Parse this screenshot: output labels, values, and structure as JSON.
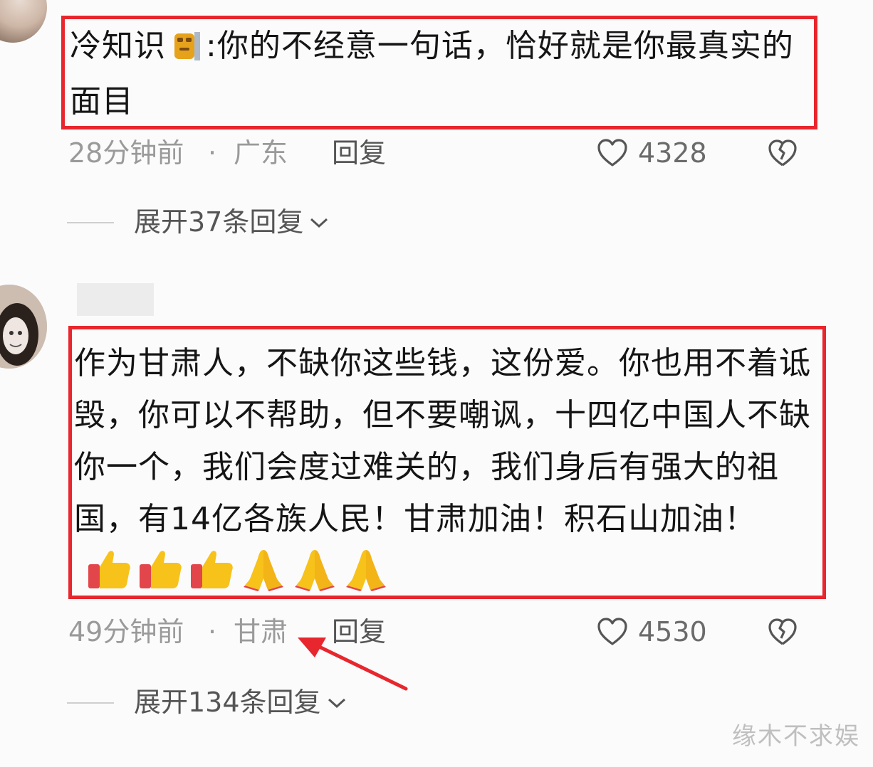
{
  "comments": [
    {
      "text_before_emoji": "冷知识",
      "emoji": "cat-face-emoji",
      "text_after_emoji": ":你的不经意一句话，恰好就是你最真实的面目",
      "time": "28分钟前",
      "separator": "·",
      "location": "广东",
      "reply_label": "回复",
      "like_count": "4328",
      "expand_label": "展开37条回复"
    },
    {
      "text": "作为甘肃人，不缺你这些钱，这份爱。你也用不着诋毁，你可以不帮助，但不要嘲讽，十四亿中国人不缺你一个，我们会度过难关的，我们身后有强大的祖国，有14亿各族人民！甘肃加油！积石山加油！",
      "emojis": [
        "thumbs-up-icon",
        "thumbs-up-icon",
        "thumbs-up-icon",
        "folded-hands-icon",
        "folded-hands-icon",
        "folded-hands-icon"
      ],
      "time": "49分钟前",
      "separator": "·",
      "location": "甘肃",
      "reply_label": "回复",
      "like_count": "4530",
      "expand_label": "展开134条回复"
    }
  ],
  "colors": {
    "highlight_border": "#e8262d",
    "arrow": "#e8262d",
    "meta_text": "#9a9a9a"
  },
  "watermark": "缘木不求娱"
}
